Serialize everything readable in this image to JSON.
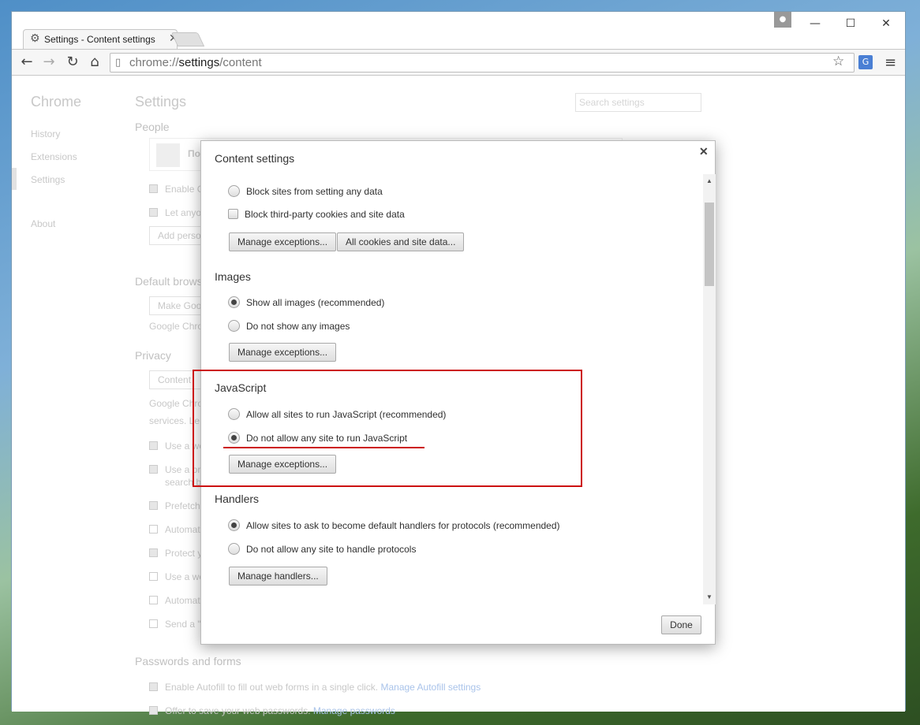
{
  "window": {
    "tab_title": "Settings - Content settings",
    "tab_close": "✕",
    "controls": {
      "minimize": "—",
      "maximize": "☐",
      "close": "✕"
    }
  },
  "toolbar": {
    "url_scheme": "chrome://",
    "url_host": "settings",
    "url_path": "/content"
  },
  "background_page": {
    "app_title": "Chrome",
    "page_title": "Settings",
    "search_placeholder": "Search settings",
    "nav": [
      "History",
      "Extensions",
      "Settings",
      "About"
    ],
    "sections": {
      "people": "People",
      "people_user": "По",
      "people_rows": [
        "Enable G",
        "Let anyo"
      ],
      "add_person": "Add perso",
      "default_browser": "Default brows",
      "make_default": "Make Goo",
      "google_chrome": "Google Chro",
      "privacy": "Privacy",
      "content_btn": "Content",
      "privacy_text1": "Google Chro",
      "privacy_text2": "services. Le",
      "privacy_rows": [
        "Use a we",
        "Use a pr",
        "search b",
        "Prefetch",
        "Automat",
        "Protect y",
        "Use a we",
        "Automat",
        "Send a \""
      ],
      "passwords": "Passwords and forms",
      "autofill": "Enable Autofill to fill out web forms in a single click.",
      "autofill_link": "Manage Autofill settings",
      "save_pw": "Offer to save your web passwords.",
      "save_pw_link": "Manage passwords"
    }
  },
  "dialog": {
    "title": "Content settings",
    "cookies": {
      "block_sites": "Block sites from setting any data",
      "block_third": "Block third-party cookies and site data",
      "manage_exceptions": "Manage exceptions...",
      "all_cookies": "All cookies and site data..."
    },
    "images": {
      "heading": "Images",
      "show_all": "Show all images (recommended)",
      "do_not_show": "Do not show any images",
      "manage_exceptions": "Manage exceptions..."
    },
    "javascript": {
      "heading": "JavaScript",
      "allow_all": "Allow all sites to run JavaScript (recommended)",
      "do_not_allow": "Do not allow any site to run JavaScript",
      "manage_exceptions": "Manage exceptions..."
    },
    "handlers": {
      "heading": "Handlers",
      "allow": "Allow sites to ask to become default handlers for protocols (recommended)",
      "do_not_allow": "Do not allow any site to handle protocols",
      "manage_handlers": "Manage handlers..."
    },
    "done": "Done"
  },
  "colors": {
    "highlight": "#cc1111"
  }
}
